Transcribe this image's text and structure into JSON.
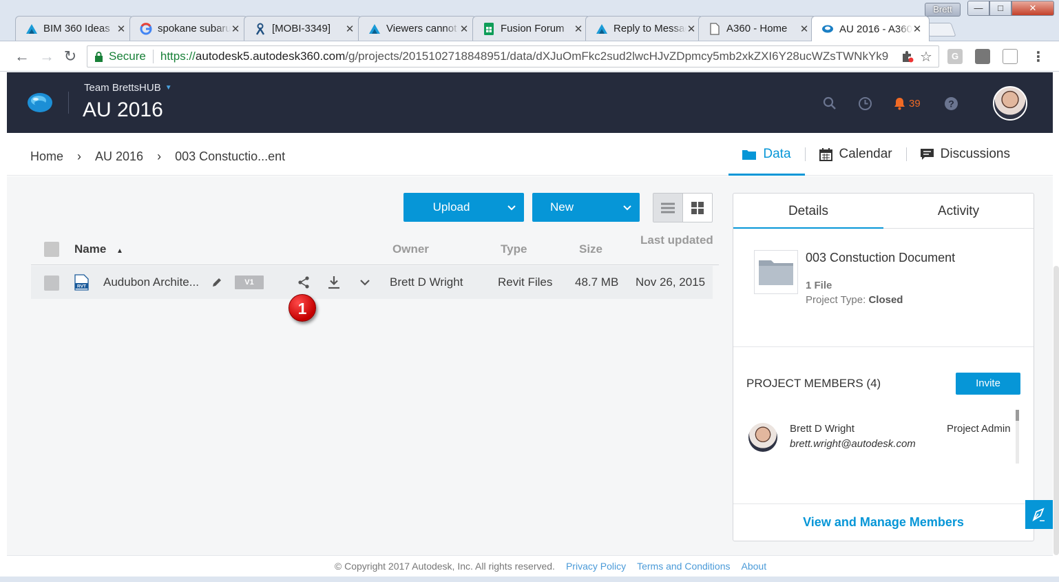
{
  "browser": {
    "tabs": [
      {
        "label": "BIM 360 Ideas",
        "icon": "autodesk-a-icon"
      },
      {
        "label": "spokane subaru",
        "icon": "google-g-icon"
      },
      {
        "label": "[MOBI-3349]",
        "icon": "jira-icon"
      },
      {
        "label": "Viewers cannot",
        "icon": "autodesk-a-icon"
      },
      {
        "label": "Fusion Forum",
        "icon": "sheets-icon"
      },
      {
        "label": "Reply to Message",
        "icon": "autodesk-a-icon"
      },
      {
        "label": "A360 - Home",
        "icon": "page-icon"
      },
      {
        "label": "AU 2016 - A360",
        "icon": "a360-icon"
      }
    ],
    "window_user": "Brett",
    "secure_label": "Secure",
    "url_scheme": "https://",
    "url_host": "autodesk5.autodesk360.com",
    "url_path": "/g/projects/20151027188489​51/data/dXJuOmFkc2sud2lwcHJvZDpmcy5mb2xkZXI6Y28ucWZsTWNkYk9"
  },
  "app": {
    "team": "Team BrettsHUB",
    "project": "AU 2016",
    "notification_count": "39"
  },
  "breadcrumb": [
    "Home",
    "AU 2016",
    "003 Constuctio...ent"
  ],
  "view_tabs": {
    "data": "Data",
    "calendar": "Calendar",
    "discussions": "Discussions"
  },
  "actions": {
    "upload": "Upload",
    "new": "New"
  },
  "table": {
    "columns": {
      "name": "Name",
      "owner": "Owner",
      "type": "Type",
      "size": "Size",
      "updated": "Last updated"
    },
    "rows": [
      {
        "name": "Audubon Archite...",
        "version": "V1",
        "owner": "Brett D Wright",
        "type": "Revit Files",
        "size": "48.7 MB",
        "updated": "Nov 26, 2015"
      }
    ]
  },
  "callout": "1",
  "details": {
    "tabs": {
      "details": "Details",
      "activity": "Activity"
    },
    "folder_title": "003 Constuction Document",
    "file_count": "1 File",
    "project_type_label": "Project Type:",
    "project_type_value": "Closed",
    "members_title": "PROJECT MEMBERS (4)",
    "invite": "Invite",
    "members": [
      {
        "name": "Brett D Wright",
        "email": "brett.wright@autodesk.com",
        "role": "Project Admin"
      }
    ],
    "manage_link": "View and Manage Members"
  },
  "footer": {
    "copyright": "© Copyright 2017 Autodesk, Inc. All rights reserved.",
    "privacy": "Privacy Policy",
    "terms": "Terms and Conditions",
    "about": "About"
  },
  "colors": {
    "accent": "#0696d7",
    "header_bg": "#252b3c",
    "notification": "#f06a25",
    "callout": "#d40000"
  }
}
